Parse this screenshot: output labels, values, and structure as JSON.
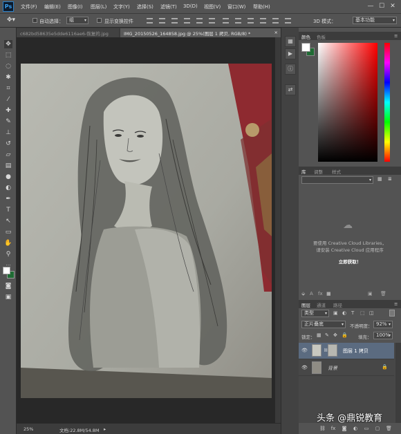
{
  "app": {
    "logo": "Ps"
  },
  "menu": [
    "文件(F)",
    "编辑(E)",
    "图像(I)",
    "图层(L)",
    "文字(Y)",
    "选择(S)",
    "滤镜(T)",
    "3D(D)",
    "视图(V)",
    "窗口(W)",
    "帮助(H)"
  ],
  "window_controls": {
    "minimize": "—",
    "maximize": "☐",
    "close": "✕"
  },
  "options": {
    "auto_select_label": "自动选择：",
    "auto_select_value": "组",
    "show_transform_label": "显示变换控件",
    "mode_3d_label": "3D 模式：",
    "workspace": "基本功能"
  },
  "tabs": [
    {
      "label": "c682bd58635e5dde6116ae6-恢复的.jpg",
      "active": false
    },
    {
      "label": "IMG_20150526_164858.jpg @ 25%(图层 1 拷贝, RGB/8) *",
      "close": "×",
      "active": true
    }
  ],
  "status": {
    "zoom": "25%",
    "doc": "文档:22.8M/54.8M",
    "arrow": "▸"
  },
  "color_panel": {
    "tab_color": "颜色",
    "tab_swatches": "色板"
  },
  "library_panel": {
    "tab_lib": "库",
    "tab_adjust": "调整",
    "tab_styles": "样式",
    "message_line1": "要使用 Creative Cloud Libraries，",
    "message_line2": "请安装 Creative Cloud 应用程序",
    "cta": "立即获取！"
  },
  "layers_panel": {
    "tab_layers": "图层",
    "tab_channels": "通道",
    "tab_paths": "路径",
    "kind_filter": "类型",
    "blend_mode": "正片叠底",
    "opacity_label": "不透明度：",
    "opacity_value": "92%",
    "lock_label": "锁定：",
    "fill_label": "填充：",
    "fill_value": "100%",
    "layers": [
      {
        "name": "图层 1 拷贝",
        "selected": true,
        "visible": true,
        "locked": false
      },
      {
        "name": "背景",
        "selected": false,
        "visible": true,
        "locked": true
      }
    ]
  },
  "watermark": "头条 @鼎锐教育"
}
